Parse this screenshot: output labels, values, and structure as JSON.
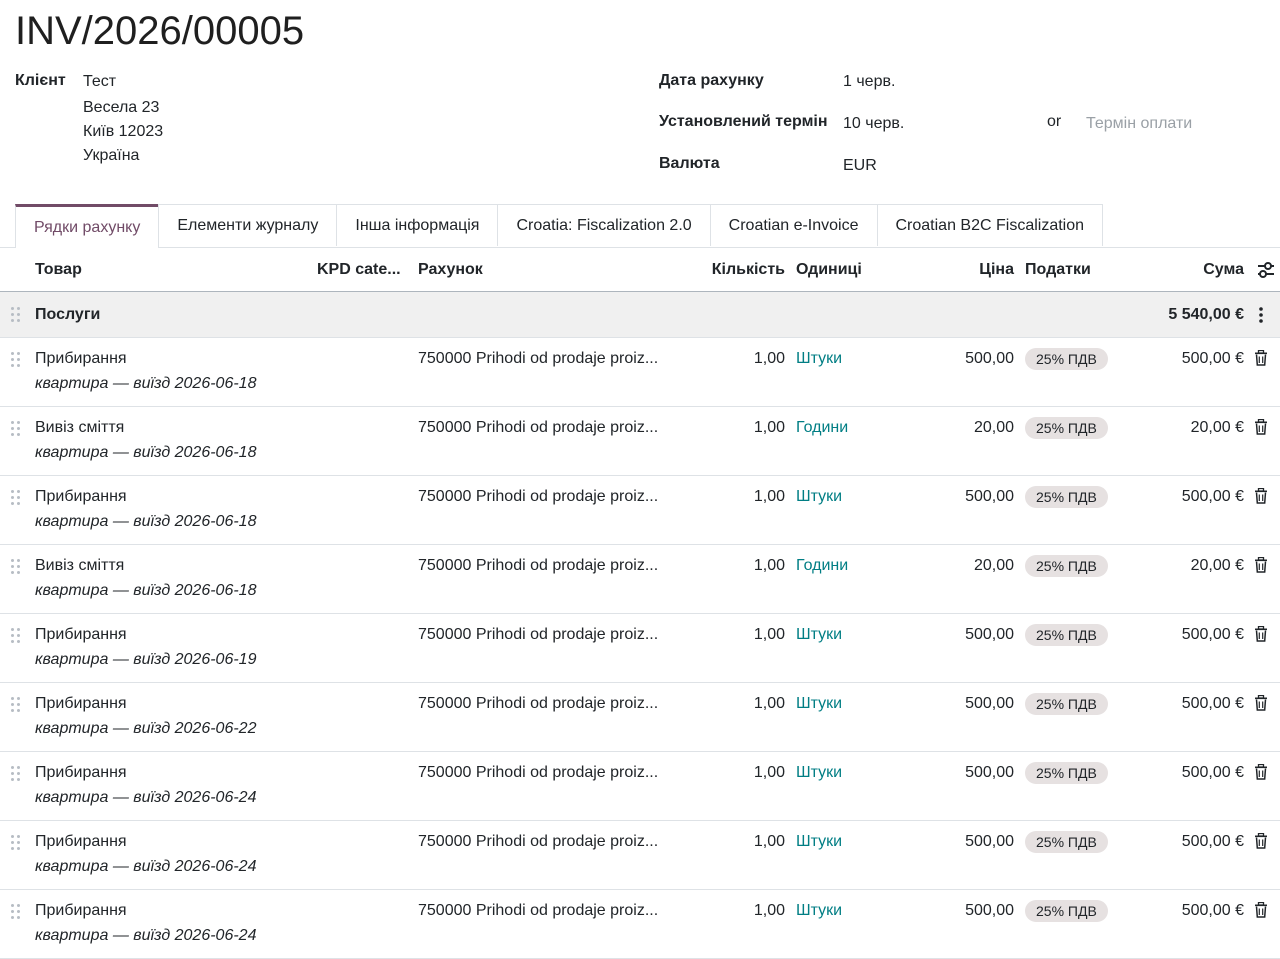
{
  "title": "INV/2026/00005",
  "customer": {
    "label": "Клієнт",
    "name": "Тест",
    "address": [
      "Весела 23",
      "Київ 12023",
      "Україна"
    ]
  },
  "invoice_date": {
    "label": "Дата рахунку",
    "value": "1 черв."
  },
  "due_date": {
    "label": "Установлений термін",
    "value": "10 черв.",
    "or": "or",
    "terms_placeholder": "Термін оплати"
  },
  "currency": {
    "label": "Валюта",
    "value": "EUR"
  },
  "tabs": [
    {
      "label": "Рядки рахунку",
      "active": true
    },
    {
      "label": "Елементи журналу"
    },
    {
      "label": "Інша інформація"
    },
    {
      "label": "Croatia: Fiscalization 2.0"
    },
    {
      "label": "Croatian e-Invoice"
    },
    {
      "label": "Croatian B2C Fiscalization"
    }
  ],
  "columns": {
    "product": "Товар",
    "kpd": "KPD cate...",
    "account": "Рахунок",
    "quantity": "Кількість",
    "uom": "Одиниці",
    "price": "Ціна",
    "taxes": "Податки",
    "amount": "Сума"
  },
  "section": {
    "name": "Послуги",
    "total": "5 540,00 €"
  },
  "lines": [
    {
      "product": "Прибирання",
      "description": "квартира — виїзд 2026-06-18",
      "account": "750000 Prihodi od prodaje proiz...",
      "quantity": "1,00",
      "uom": "Штуки",
      "price": "500,00",
      "tax": "25% ПДВ",
      "amount": "500,00 €"
    },
    {
      "product": "Вивіз сміття",
      "description": "квартира — виїзд 2026-06-18",
      "account": "750000 Prihodi od prodaje proiz...",
      "quantity": "1,00",
      "uom": "Години",
      "price": "20,00",
      "tax": "25% ПДВ",
      "amount": "20,00 €"
    },
    {
      "product": "Прибирання",
      "description": "квартира — виїзд 2026-06-18",
      "account": "750000 Prihodi od prodaje proiz...",
      "quantity": "1,00",
      "uom": "Штуки",
      "price": "500,00",
      "tax": "25% ПДВ",
      "amount": "500,00 €"
    },
    {
      "product": "Вивіз сміття",
      "description": "квартира — виїзд 2026-06-18",
      "account": "750000 Prihodi od prodaje proiz...",
      "quantity": "1,00",
      "uom": "Години",
      "price": "20,00",
      "tax": "25% ПДВ",
      "amount": "20,00 €"
    },
    {
      "product": "Прибирання",
      "description": "квартира — виїзд 2026-06-19",
      "account": "750000 Prihodi od prodaje proiz...",
      "quantity": "1,00",
      "uom": "Штуки",
      "price": "500,00",
      "tax": "25% ПДВ",
      "amount": "500,00 €"
    },
    {
      "product": "Прибирання",
      "description": "квартира — виїзд 2026-06-22",
      "account": "750000 Prihodi od prodaje proiz...",
      "quantity": "1,00",
      "uom": "Штуки",
      "price": "500,00",
      "tax": "25% ПДВ",
      "amount": "500,00 €"
    },
    {
      "product": "Прибирання",
      "description": "квартира — виїзд 2026-06-24",
      "account": "750000 Prihodi od prodaje proiz...",
      "quantity": "1,00",
      "uom": "Штуки",
      "price": "500,00",
      "tax": "25% ПДВ",
      "amount": "500,00 €"
    },
    {
      "product": "Прибирання",
      "description": "квартира — виїзд 2026-06-24",
      "account": "750000 Prihodi od prodaje proiz...",
      "quantity": "1,00",
      "uom": "Штуки",
      "price": "500,00",
      "tax": "25% ПДВ",
      "amount": "500,00 €"
    },
    {
      "product": "Прибирання",
      "description": "квартира — виїзд 2026-06-24",
      "account": "750000 Prihodi od prodaje proiz...",
      "quantity": "1,00",
      "uom": "Штуки",
      "price": "500,00",
      "tax": "25% ПДВ",
      "amount": "500,00 €"
    }
  ],
  "colors": {
    "accent": "#714b67",
    "uom_link": "#017e84",
    "section_bg": "#f0f0f0",
    "tax_badge_bg": "#e6e1e1"
  }
}
